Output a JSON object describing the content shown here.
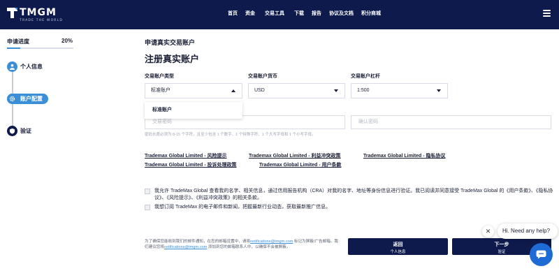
{
  "brand": {
    "name": "TMGM",
    "tagline": "TRADE THE WORLD",
    "nav_bg": "#0d1a4b",
    "accent": "#3b8fd6"
  },
  "nav": {
    "items": [
      {
        "label": "首页"
      },
      {
        "label": "资金"
      },
      {
        "label": "交易工具"
      },
      {
        "label": "下载"
      },
      {
        "label": "报告"
      },
      {
        "label": "协议及文档"
      },
      {
        "label": "积分商城"
      }
    ]
  },
  "sidebar": {
    "progress_label": "申请进度",
    "progress_value": "20%",
    "progress_fraction": 0.2,
    "steps": [
      {
        "label": "个人信息",
        "icon": "person-icon"
      },
      {
        "label": "账户配置",
        "icon": "gear-icon"
      },
      {
        "label": "验证",
        "icon": "shield-icon"
      }
    ]
  },
  "main": {
    "breadcrumb": "申请真实交易账户",
    "title": "注册真实账户",
    "fields": {
      "account_type": {
        "label": "交易账户类型",
        "value": "标准账户"
      },
      "currency": {
        "label": "交易账户货币",
        "value": "USD"
      },
      "leverage": {
        "label": "交易账户杠杆",
        "value": "1:500"
      }
    },
    "dropdown_option": "标准账户",
    "password_placeholder": "交易密码",
    "confirm_placeholder": "确认密码",
    "password_hint": "密码长度必须为 8-15 个字符，且至少包含 1 个数字、1 个特殊字符、1 个大写字母和 1 个小写字母。",
    "links": [
      "Trademax Global Limited - 风险提示",
      "Trademax Global Limited - 利益冲突政策",
      "Trademax Global Limited - 隐私协议",
      "Trademax Global Limited - 投诉处理政策",
      "Trademax Global Limited - 用户条款"
    ],
    "consent_text": "我允许 TradeMax Global 查看我的名字、相关信息，通过信用报告机构（CRA）对我的名字、地址等身份信息进行验证。我已阅读并同意接受 TradeMax Global 的《用户条款》、《隐私协议》、《风险提示》、《利益冲突政策》的相关条款。",
    "newsletter_text": "我想订阅 TradeMax 的电子邮件和新闻，把握最新行业动态，获取最新推广信息。",
    "footer_note_1": "为了确保您能收到我们的邮件通知，在您的邮箱设置中，请将",
    "footer_email_1": "notifications@tmgm.com",
    "footer_note_2": " 标记为屏蔽/广告邮箱。我们建议您将",
    "footer_email_2": "notifications@tmgm.com",
    "footer_note_3": " 添加到您的邮箱联系人中，以确保不会被屏蔽。",
    "back_button": {
      "title": "返回",
      "sub": "个人信息"
    },
    "next_button": {
      "title": "下一步",
      "sub": "验证"
    }
  },
  "chat": {
    "greeting": "Hi. Need any help?",
    "close_glyph": "✕"
  }
}
